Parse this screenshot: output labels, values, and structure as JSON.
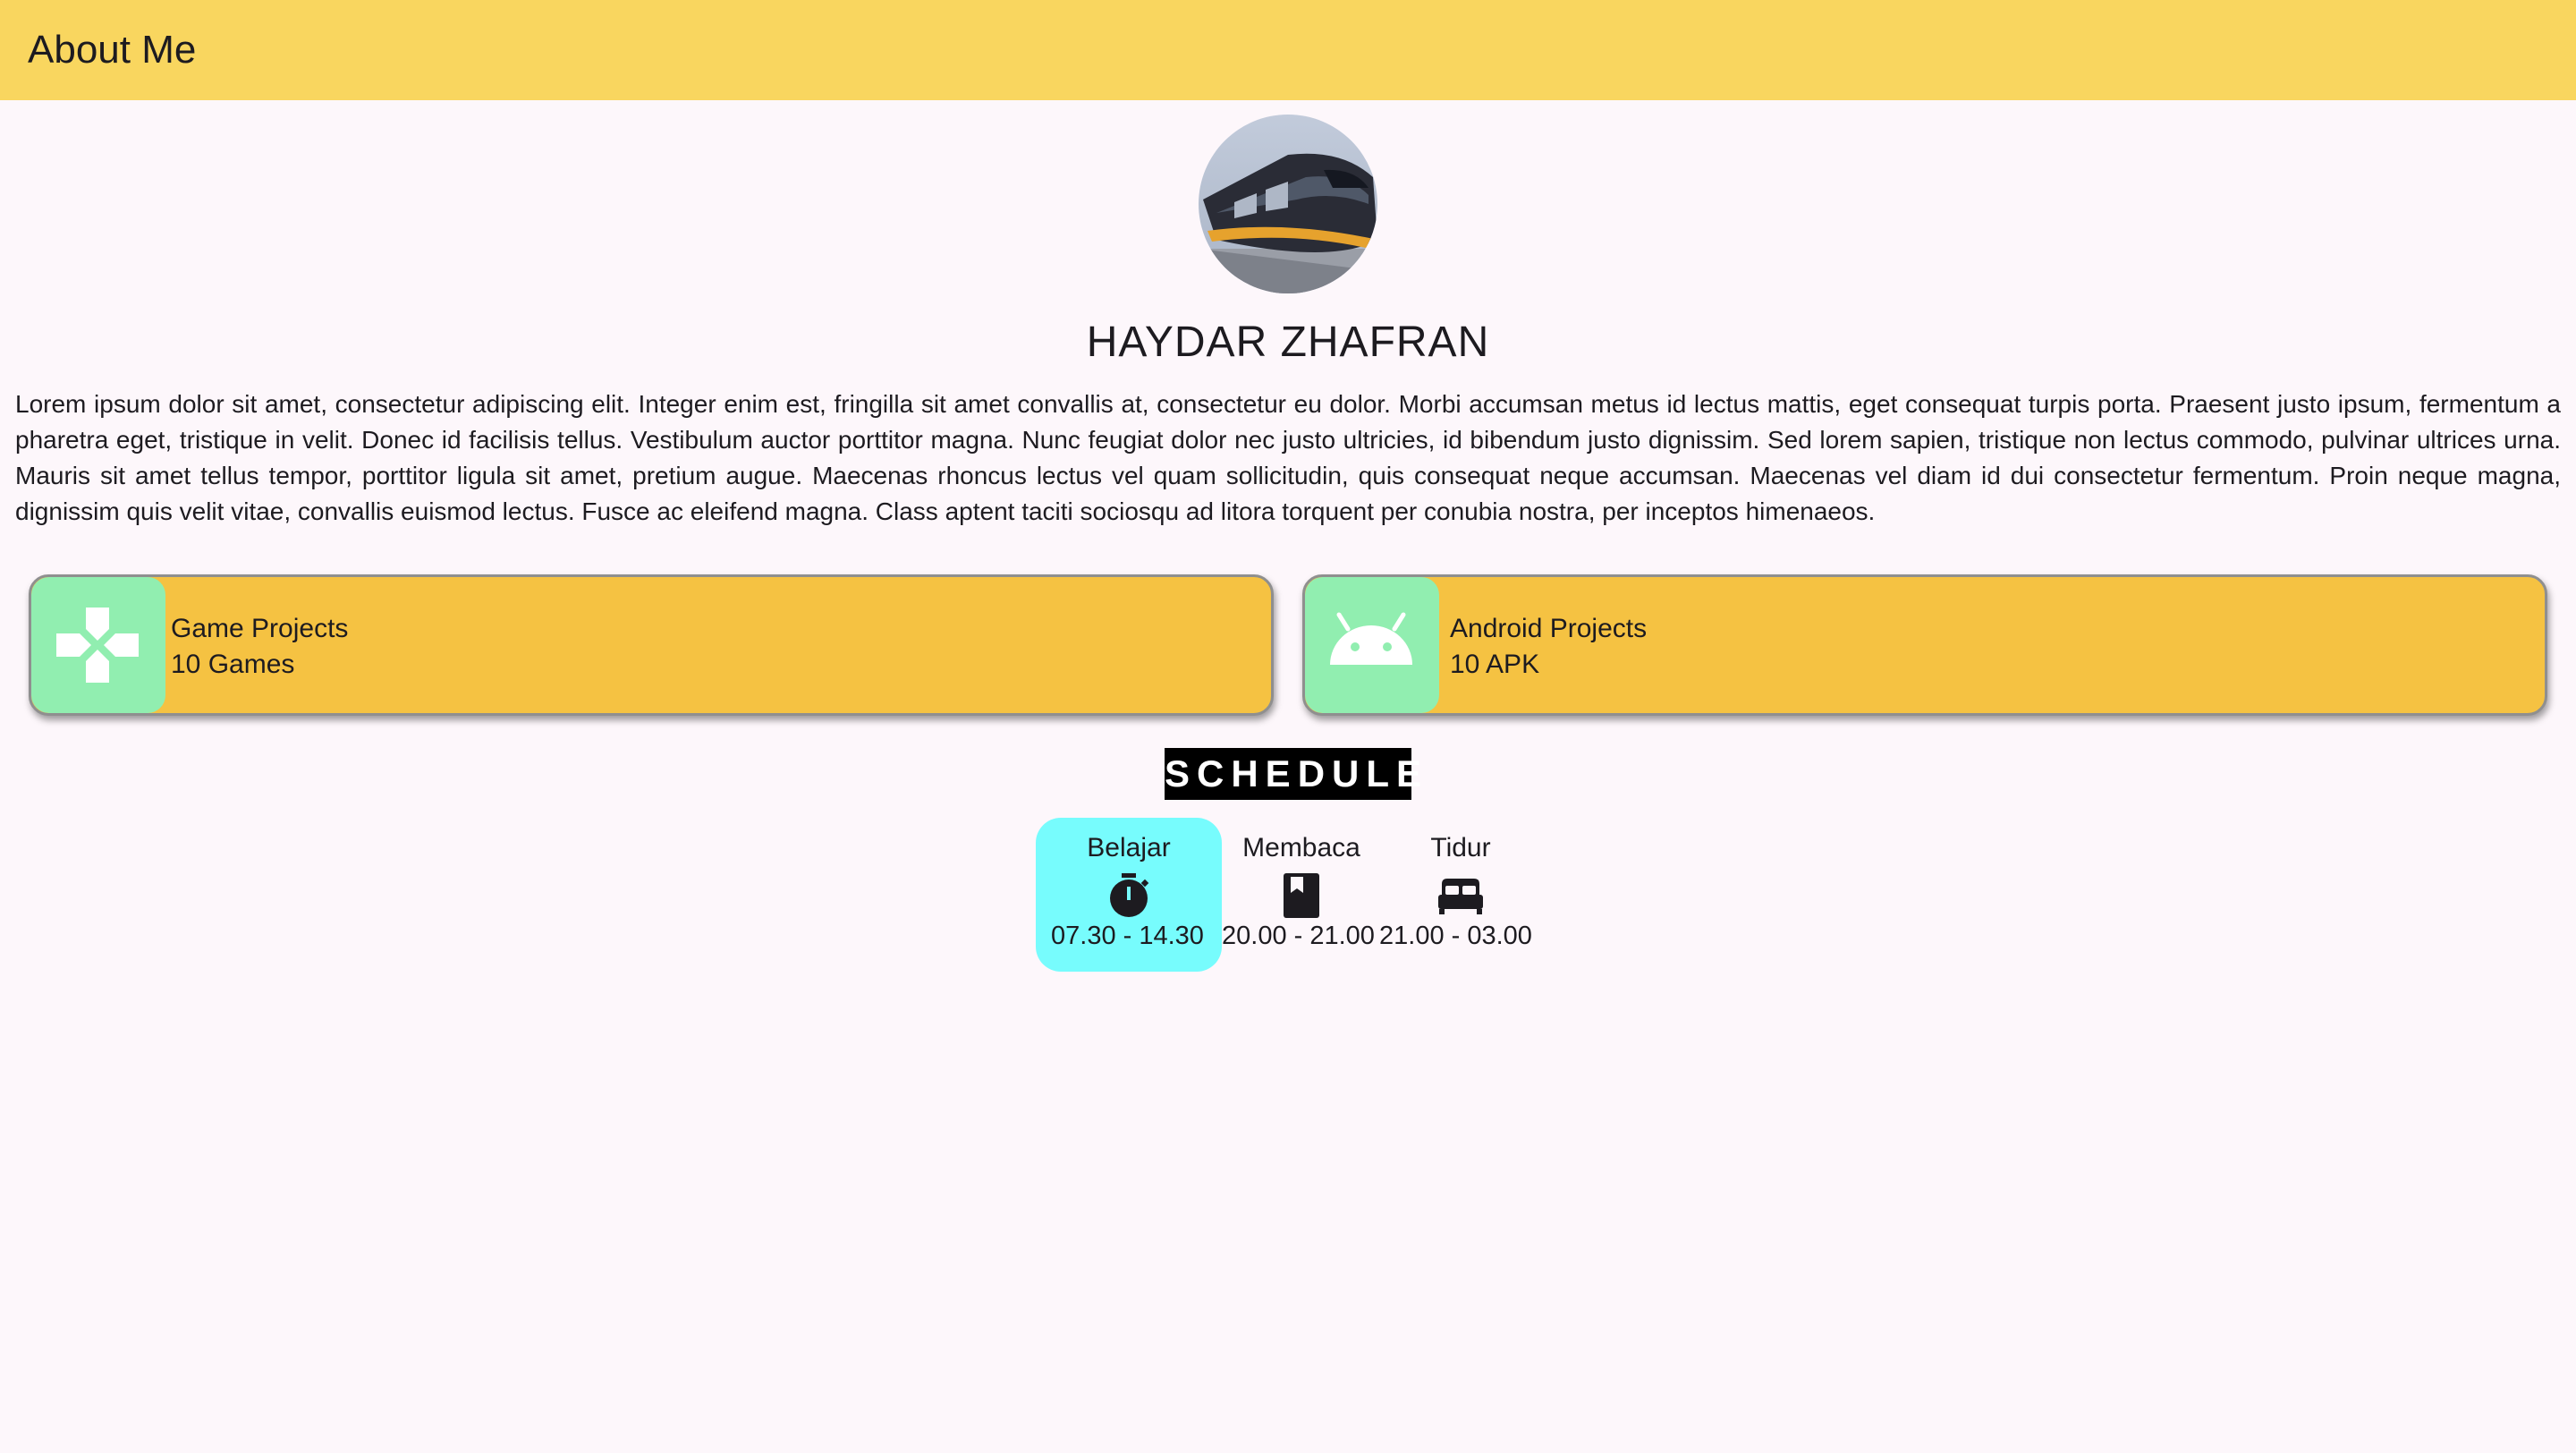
{
  "appbar": {
    "title": "About Me"
  },
  "profile": {
    "avatar_icon": "train-photo-avatar",
    "name": "HAYDAR ZHAFRAN",
    "bio": "Lorem ipsum dolor sit amet, consectetur adipiscing elit. Integer enim est, fringilla sit amet convallis at, consectetur eu dolor. Morbi accumsan metus id lectus mattis, eget consequat turpis porta. Praesent justo ipsum, fermentum a pharetra eget, tristique in velit. Donec id facilisis tellus. Vestibulum auctor porttitor magna. Nunc feugiat dolor nec justo ultricies, id bibendum justo dignissim. Sed lorem sapien, tristique non lectus commodo, pulvinar ultrices urna. Mauris sit amet tellus tempor, porttitor ligula sit amet, pretium augue. Maecenas rhoncus lectus vel quam sollicitudin, quis consequat neque accumsan. Maecenas vel diam id dui consectetur fermentum. Proin neque magna, dignissim quis velit vitae, convallis euismod lectus. Fusce ac eleifend magna. Class aptent taciti sociosqu ad litora torquent per conubia nostra, per inceptos himenaeos."
  },
  "cards": [
    {
      "title": "Game Projects",
      "subtitle": "10 Games",
      "icon": "gamepad-icon"
    },
    {
      "title": "Android Projects",
      "subtitle": "10 APK",
      "icon": "android-icon"
    }
  ],
  "schedule": {
    "title": "SCHEDULE",
    "items": [
      {
        "label": "Belajar",
        "time": "07.30 - 14.30",
        "icon": "timer-icon",
        "active": true
      },
      {
        "label": "Membaca",
        "time": "20.00 - 21.00",
        "icon": "book-icon",
        "active": false
      },
      {
        "label": "Tidur",
        "time": "21.00 - 03.00",
        "icon": "bed-icon",
        "active": false
      }
    ]
  },
  "colors": {
    "appbar": "#f9d65f",
    "background": "#fdf7fb",
    "card": "#f5c242",
    "card_icon_bg": "#91eeb0",
    "schedule_active": "#77fcfd"
  }
}
